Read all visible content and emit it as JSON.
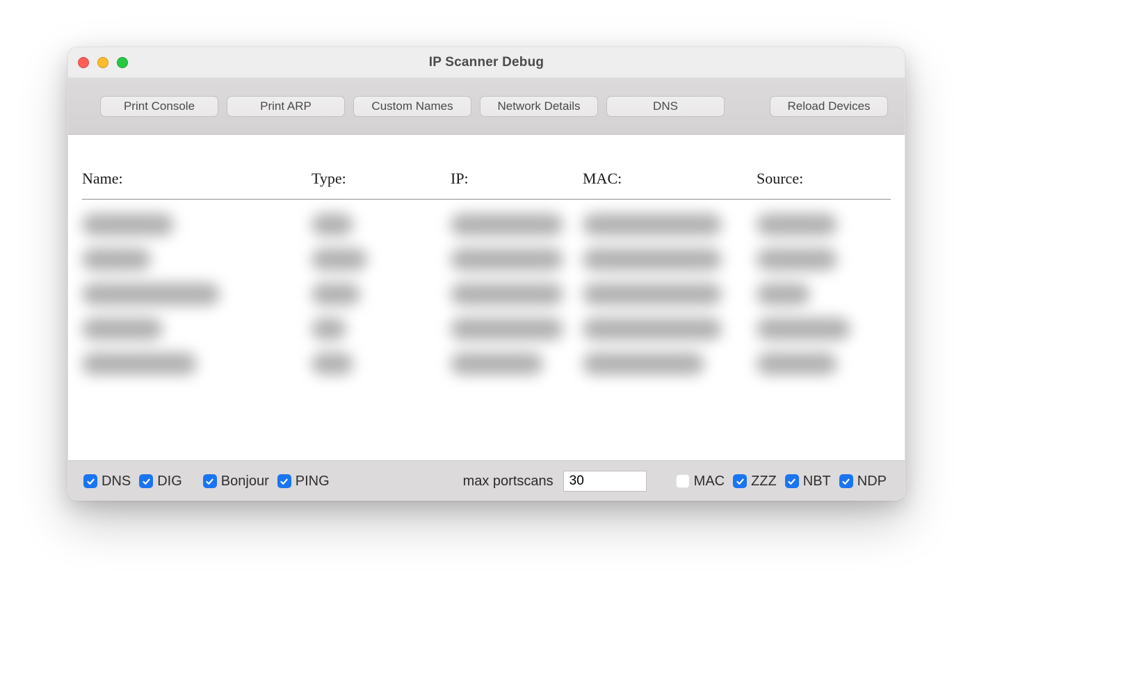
{
  "window": {
    "title": "IP Scanner Debug"
  },
  "toolbar": {
    "print_console": "Print Console",
    "print_arp": "Print ARP",
    "custom_names": "Custom Names",
    "network_details": "Network Details",
    "dns": "DNS",
    "reload_devices": "Reload Devices"
  },
  "columns": {
    "name": "Name:",
    "type": "Type:",
    "ip": "IP:",
    "mac": "MAC:",
    "source": "Source:"
  },
  "footer": {
    "dns": "DNS",
    "dig": "DIG",
    "bonjour": "Bonjour",
    "ping": "PING",
    "max_portscans_label": "max portscans",
    "max_portscans_value": "30",
    "mac": "MAC",
    "zzz": "ZZZ",
    "nbt": "NBT",
    "ndp": "NDP"
  },
  "checks": {
    "dns": true,
    "dig": true,
    "bonjour": true,
    "ping": true,
    "mac": false,
    "zzz": true,
    "nbt": true,
    "ndp": true
  }
}
